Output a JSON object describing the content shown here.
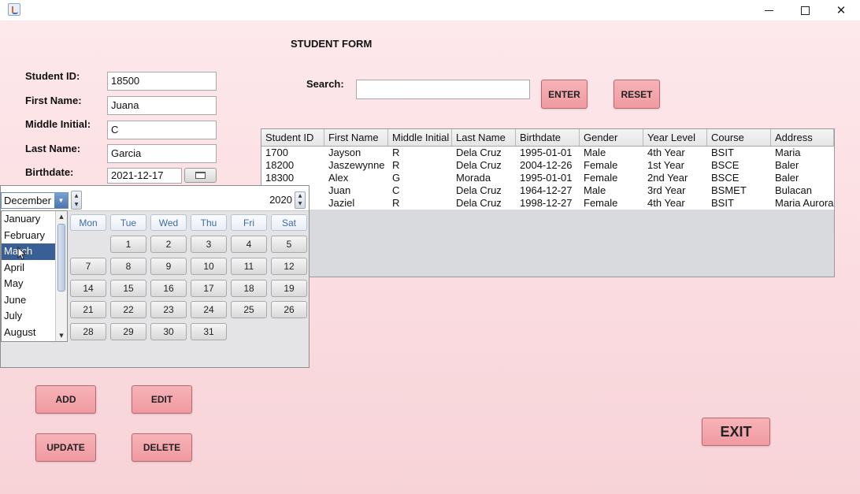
{
  "window": {
    "min_icon": "minimize-icon",
    "max_icon": "maximize-icon",
    "close_icon": "close-icon"
  },
  "form": {
    "title": "STUDENT FORM",
    "student_id_label": "Student ID:",
    "student_id_value": "18500",
    "first_name_label": "First Name:",
    "first_name_value": "Juana",
    "middle_initial_label": "Middle Initial:",
    "middle_initial_value": "C",
    "last_name_label": "Last Name:",
    "last_name_value": "Garcia",
    "birthdate_label": "Birthdate:",
    "birthdate_value": "2021-12-17"
  },
  "search": {
    "label": "Search:",
    "value": "",
    "enter_label": "ENTER",
    "reset_label": "RESET"
  },
  "table": {
    "columns": [
      "Student ID",
      "First Name",
      "Middle Initial",
      "Last Name",
      "Birthdate",
      "Gender",
      "Year Level",
      "Course",
      "Address"
    ],
    "rows": [
      [
        "1700",
        "Jayson",
        "R",
        "Dela Cruz",
        "1995-01-01",
        "Male",
        "4th Year",
        "BSIT",
        "Maria"
      ],
      [
        "18200",
        "Jaszewynne",
        "R",
        "Dela Cruz",
        "2004-12-26",
        "Female",
        "1st Year",
        "BSCE",
        "Baler"
      ],
      [
        "18300",
        "Alex",
        "G",
        "Morada",
        "1995-01-01",
        "Female",
        "2nd Year",
        "BSCE",
        "Baler"
      ],
      [
        "",
        "Juan",
        "C",
        "Dela Cruz",
        "1964-12-27",
        "Male",
        "3rd Year",
        "BSMET",
        "Bulacan"
      ],
      [
        "",
        "Jaziel",
        "R",
        "Dela Cruz",
        "1998-12-27",
        "Female",
        "4th Year",
        "BSIT",
        "Maria Aurora"
      ]
    ]
  },
  "calendar": {
    "month": "December",
    "year": "2020",
    "months_visible": [
      "January",
      "February",
      "March",
      "April",
      "May",
      "June",
      "July",
      "August"
    ],
    "selected_month_index": 2,
    "weekdays": [
      "Mon",
      "Tue",
      "Wed",
      "Thu",
      "Fri",
      "Sat"
    ],
    "days": [
      "1",
      "2",
      "3",
      "4",
      "5",
      "7",
      "8",
      "9",
      "10",
      "11",
      "12",
      "14",
      "15",
      "16",
      "17",
      "18",
      "19",
      "21",
      "22",
      "23",
      "24",
      "25",
      "26",
      "28",
      "29",
      "30",
      "31"
    ]
  },
  "buttons": {
    "add": "ADD",
    "edit": "EDIT",
    "update": "UPDATE",
    "delete": "DELETE",
    "exit": "EXIT"
  }
}
